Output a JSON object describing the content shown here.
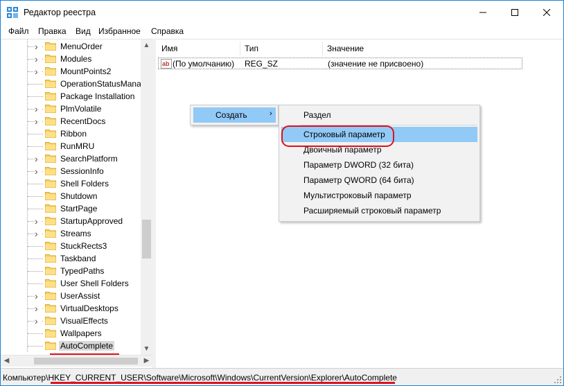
{
  "window": {
    "title": "Редактор реестра",
    "accent_color": "#1883d7",
    "controls": {
      "minimize": "minimize-icon",
      "maximize": "maximize-icon",
      "close": "close-icon"
    }
  },
  "menu": [
    "Файл",
    "Правка",
    "Вид",
    "Избранное",
    "Справка"
  ],
  "tree": {
    "items": [
      {
        "label": "MenuOrder",
        "expandable": true
      },
      {
        "label": "Modules",
        "expandable": true
      },
      {
        "label": "MountPoints2",
        "expandable": true
      },
      {
        "label": "OperationStatusMana",
        "expandable": false
      },
      {
        "label": "Package Installation",
        "expandable": false
      },
      {
        "label": "PlmVolatile",
        "expandable": true
      },
      {
        "label": "RecentDocs",
        "expandable": true
      },
      {
        "label": "Ribbon",
        "expandable": false
      },
      {
        "label": "RunMRU",
        "expandable": false
      },
      {
        "label": "SearchPlatform",
        "expandable": true
      },
      {
        "label": "SessionInfo",
        "expandable": true
      },
      {
        "label": "Shell Folders",
        "expandable": false
      },
      {
        "label": "Shutdown",
        "expandable": false
      },
      {
        "label": "StartPage",
        "expandable": false
      },
      {
        "label": "StartupApproved",
        "expandable": true
      },
      {
        "label": "Streams",
        "expandable": true
      },
      {
        "label": "StuckRects3",
        "expandable": false
      },
      {
        "label": "Taskband",
        "expandable": false
      },
      {
        "label": "TypedPaths",
        "expandable": false
      },
      {
        "label": "User Shell Folders",
        "expandable": false
      },
      {
        "label": "UserAssist",
        "expandable": true
      },
      {
        "label": "VirtualDesktops",
        "expandable": true
      },
      {
        "label": "VisualEffects",
        "expandable": true
      },
      {
        "label": "Wallpapers",
        "expandable": false
      },
      {
        "label": "AutoComplete",
        "expandable": false,
        "selected": true
      }
    ]
  },
  "list": {
    "columns": [
      "Имя",
      "Тип",
      "Значение"
    ],
    "rows": [
      {
        "name": "(По умолчанию)",
        "type": "REG_SZ",
        "value": "(значение не присвоено)",
        "icon": "string-value-icon"
      }
    ]
  },
  "context_menu": {
    "create_label": "Создать",
    "submenu": [
      "Раздел",
      "Строковый параметр",
      "Двоичный параметр",
      "Параметр DWORD (32 бита)",
      "Параметр QWORD (64 бита)",
      "Мультистроковый параметр",
      "Расширяемый строковый параметр"
    ],
    "hovered_index": 1,
    "highlight_color": "#91c9f7",
    "annotation_color": "#e0101a"
  },
  "status": {
    "path": "Компьютер\\HKEY_CURRENT_USER\\Software\\Microsoft\\Windows\\CurrentVersion\\Explorer\\AutoComplete"
  }
}
